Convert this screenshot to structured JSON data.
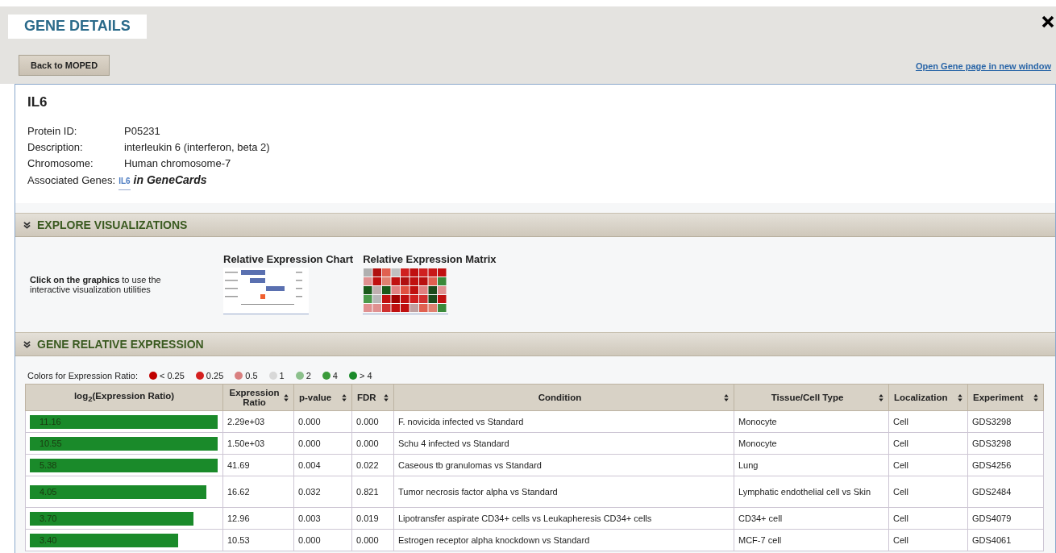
{
  "header": {
    "title": "GENE DETAILS",
    "back_button": "Back to MOPED",
    "open_link": "Open Gene page in new window"
  },
  "gene": {
    "name": "IL6",
    "fields": [
      {
        "label": "Protein ID:",
        "value": "P05231"
      },
      {
        "label": "Description:",
        "value": "interleukin 6 (interferon, beta 2)"
      },
      {
        "label": "Chromosome:",
        "value": "Human chromosome-7"
      }
    ],
    "associated": {
      "label": "Associated Genes:",
      "link": "IL6",
      "suffix": "in GeneCards"
    }
  },
  "visualizations": {
    "title": "EXPLORE VISUALIZATIONS",
    "expanded": true,
    "hint": "**Click on the graphics** to use the interactive visualization utilities",
    "items": [
      {
        "kind": "chart",
        "title": "Relative Expression Chart"
      },
      {
        "kind": "matrix",
        "title": "Relative Expression Matrix"
      }
    ]
  },
  "expression": {
    "title": "GENE RELATIVE EXPRESSION",
    "expanded": true,
    "legend_label": "Colors for Expression Ratio:",
    "legend": [
      {
        "label": "< 0.25",
        "color": "#c00000"
      },
      {
        "label": "0.25",
        "color": "#d42020"
      },
      {
        "label": "0.5",
        "color": "#d98080"
      },
      {
        "label": "1",
        "color": "#d8d8d8"
      },
      {
        "label": "2",
        "color": "#8cc08c"
      },
      {
        "label": "4",
        "color": "#3a9a3a"
      },
      {
        "label": "> 4",
        "color": "#1a8a2a"
      }
    ],
    "columns": [
      {
        "label": "log$_{2}$(Expression Ratio)",
        "sortable": false
      },
      {
        "label": "Expression Ratio",
        "sortable": true
      },
      {
        "label": "p-value",
        "sortable": true
      },
      {
        "label": "FDR",
        "sortable": true
      },
      {
        "label": "Condition",
        "sortable": true
      },
      {
        "label": "Tissue/Cell Type",
        "sortable": true
      },
      {
        "label": "Localization",
        "sortable": true
      },
      {
        "label": "Experiment",
        "sortable": true
      }
    ],
    "rows": [
      {
        "log2": "11.16",
        "level": 1,
        "color": "#1a8a2a",
        "ratio": "2.29e+03",
        "p": "0.000",
        "fdr": "0.000",
        "condition": "F. novicida infected vs Standard",
        "tissue": "Monocyte",
        "localization": "Cell",
        "experiment": "GDS3298"
      },
      {
        "log2": "10.55",
        "level": 1,
        "color": "#1a8a2a",
        "ratio": "1.50e+03",
        "p": "0.000",
        "fdr": "0.000",
        "condition": "Schu 4 infected vs Standard",
        "tissue": "Monocyte",
        "localization": "Cell",
        "experiment": "GDS3298"
      },
      {
        "log2": "5.38",
        "level": 1,
        "color": "#1a8a2a",
        "ratio": "41.69",
        "p": "0.004",
        "fdr": "0.022",
        "condition": "Caseous tb granulomas vs Standard",
        "tissue": "Lung",
        "localization": "Cell",
        "experiment": "GDS4256"
      },
      {
        "log2": "4.05",
        "level": 0.94,
        "color": "#1a8a2a",
        "ratio": "16.62",
        "p": "0.032",
        "fdr": "0.821",
        "condition": "Tumor necrosis factor alpha vs Standard",
        "tissue": "Lymphatic endothelial cell vs Skin",
        "localization": "Cell",
        "experiment": "GDS2484"
      },
      {
        "log2": "3.70",
        "level": 0.87,
        "color": "#1a8a2a",
        "ratio": "12.96",
        "p": "0.003",
        "fdr": "0.019",
        "condition": "Lipotransfer aspirate CD34+ cells vs Leukapheresis CD34+ cells",
        "tissue": "CD34+ cell",
        "localization": "Cell",
        "experiment": "GDS4079"
      },
      {
        "log2": "3.40",
        "level": 0.79,
        "color": "#1a8a2a",
        "ratio": "10.53",
        "p": "0.000",
        "fdr": "0.000",
        "condition": "Estrogen receptor alpha knockdown vs Standard",
        "tissue": "MCF-7 cell",
        "localization": "Cell",
        "experiment": "GDS4061"
      }
    ]
  }
}
